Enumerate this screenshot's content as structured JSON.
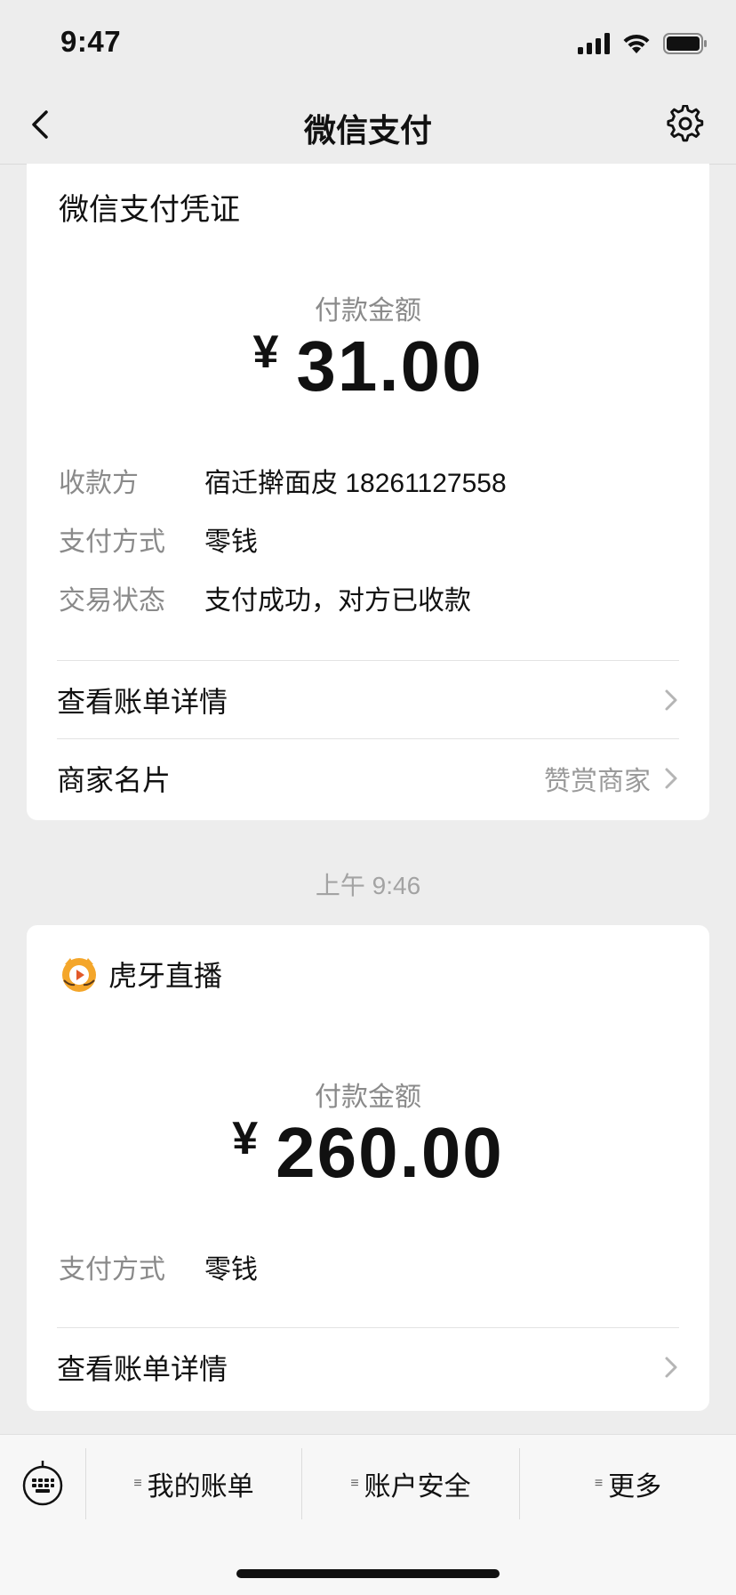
{
  "status_bar": {
    "time": "9:47"
  },
  "nav": {
    "title": "微信支付"
  },
  "card1": {
    "title": "微信支付凭证",
    "amount_label": "付款金额",
    "currency": "¥",
    "amount": "31.00",
    "rows": [
      {
        "label": "收款方",
        "value": "宿迁擀面皮 18261127558"
      },
      {
        "label": "支付方式",
        "value": "零钱"
      },
      {
        "label": "交易状态",
        "value": "支付成功，对方已收款"
      }
    ],
    "links": [
      {
        "label": "查看账单详情",
        "extra": ""
      },
      {
        "label": "商家名片",
        "extra": "赞赏商家"
      }
    ]
  },
  "timestamp": "上午 9:46",
  "card2": {
    "merchant": "虎牙直播",
    "amount_label": "付款金额",
    "currency": "¥",
    "amount": "260.00",
    "rows": [
      {
        "label": "支付方式",
        "value": "零钱"
      }
    ],
    "links": [
      {
        "label": "查看账单详情"
      }
    ]
  },
  "tabbar": {
    "tabs": [
      {
        "label": "我的账单",
        "glyph": "≡"
      },
      {
        "label": "账户安全",
        "glyph": "≡"
      },
      {
        "label": "更多",
        "glyph": "≡"
      }
    ]
  },
  "icons": {
    "back": "chevron-left-icon",
    "settings": "gear-icon",
    "keyboard": "keyboard-icon",
    "merchant_logo": "huya-logo-icon"
  },
  "colors": {
    "background": "#ededed",
    "card": "#ffffff",
    "secondary_text": "#8a8a8a"
  }
}
